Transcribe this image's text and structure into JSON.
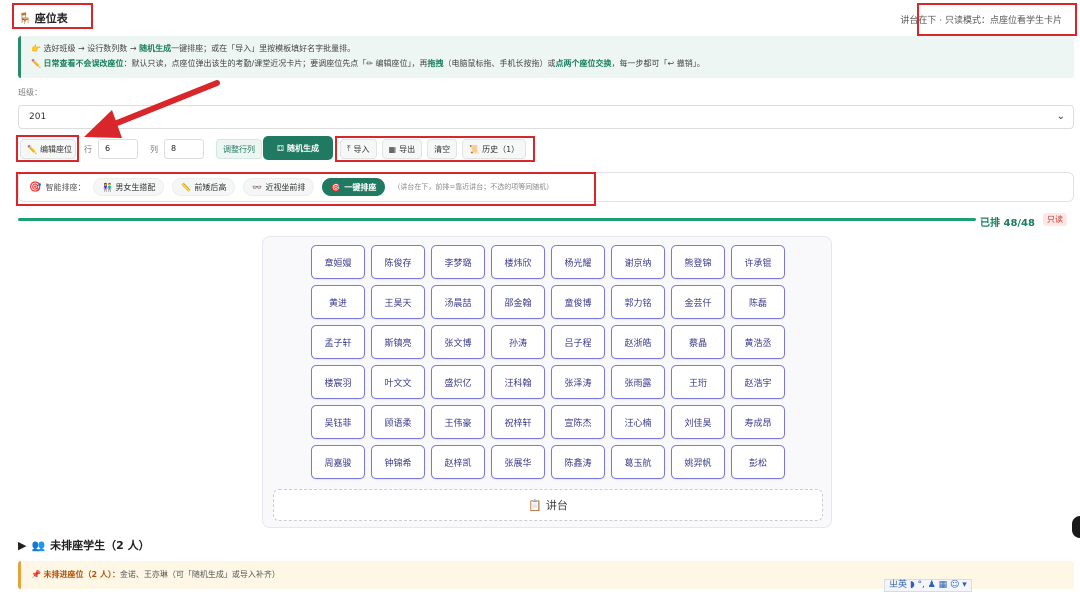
{
  "header": {
    "title": "座位表",
    "mode_text": "讲台在下 · 只读模式：点座位看学生卡片"
  },
  "tips": {
    "line1_lead": "选好班级 → 设行数列数 → ",
    "line1_action": "随机生成",
    "line1_rest": "一键排座；或在「导入」里按模板填好名字批量排。",
    "line2_lead": "日常查看不会误改座位",
    "line2_mid": "：默认只读，点座位弹出该生的考勤/课堂近况卡片；要调座位先点「✏ 编辑座位」，再",
    "line2_drag": "拖拽",
    "line2_mid2": "（电脑鼠标拖、手机长按拖）或",
    "line2_swap": "点两个座位交换",
    "line2_tail": "，每一步都可「↩ 撤销」。"
  },
  "class_selector": {
    "label": "班级：",
    "value": "201"
  },
  "toolbar": {
    "edit_label": "编辑座位",
    "rows_label": "行",
    "rows_value": "6",
    "cols_label": "列",
    "cols_value": "8",
    "resize_label": "调整行列",
    "random_label": "随机生成",
    "import_label": "导入",
    "export_label": "导出",
    "clear_label": "清空",
    "history_label": "历史（1）"
  },
  "smart": {
    "label": "智能排座：",
    "gender_label": "男女生搭配",
    "height_label": "前矮后高",
    "vision_label": "近视坐前排",
    "oneclick_label": "一键排座",
    "hint": "（讲台在下，前排=靠近讲台；不选的项等同随机）"
  },
  "status": {
    "seated_text": "已排 48/48",
    "readonly_badge": "只读",
    "seated_count": 48,
    "total_count": 48
  },
  "seats": [
    "章姮嫚",
    "陈俊存",
    "李梦璐",
    "楼炜欣",
    "杨光耀",
    "谢京纳",
    "熊登锦",
    "许承锟",
    "黄进",
    "王昊天",
    "汤晨喆",
    "邵金翰",
    "童俊博",
    "郭力铭",
    "金芸仟",
    "陈磊",
    "孟子轩",
    "斯镇亮",
    "张文博",
    "孙涛",
    "吕子程",
    "赵浙皓",
    "蔡晶",
    "黄浩丞",
    "楼宸羽",
    "叶文文",
    "盛炽亿",
    "汪科翰",
    "张泽涛",
    "张雨露",
    "王珩",
    "赵浩宇",
    "吴钰菲",
    "顾语柔",
    "王伟豪",
    "祝梓轩",
    "宣陈杰",
    "汪心楠",
    "刘佳昊",
    "寿成昂",
    "周嘉骏",
    "钟锦希",
    "赵梓凯",
    "张展华",
    "陈鑫涛",
    "葛玉航",
    "姚羿帆",
    "彭松"
  ],
  "podium_label": "讲台",
  "unseated": {
    "title": "未排座学生（2 人）",
    "banner_lead": "未排进座位（2 人）：",
    "banner_names": "金诺、王亦琳（可「随机生成」或导入补齐）"
  },
  "ime": {
    "text": "ㄓ英 ◗ °, ♟ ▦ ☺ ▾"
  },
  "colors": {
    "accent": "#1f7a61",
    "seat_border": "#7a7ad6",
    "annotation_red": "#d9262b"
  }
}
